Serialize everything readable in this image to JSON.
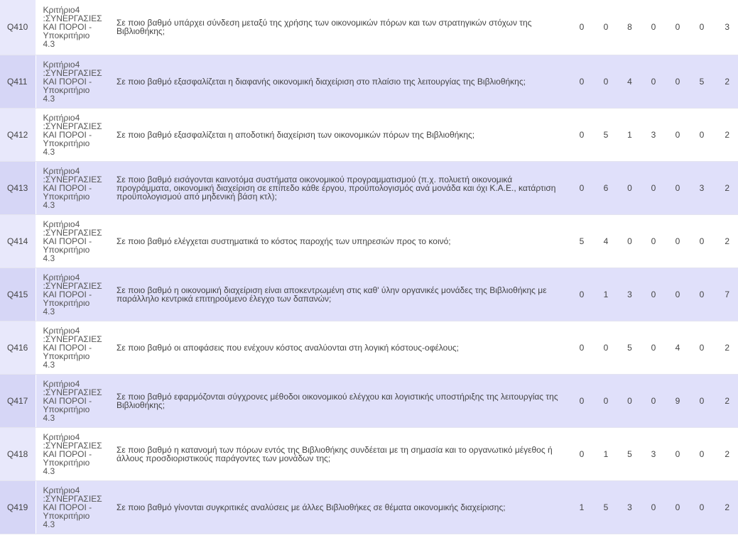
{
  "rows": [
    {
      "id": "Q410",
      "criterion": [
        "Κριτήριο4",
        ":ΣΥΝΕΡΓΑΣΙΕΣ",
        "ΚΑΙ ΠΟΡΟΙ -",
        "Υποκριτήριο",
        "4.3"
      ],
      "question": "Σε ποιο βαθμό υπάρχει σύνδεση μεταξύ της χρήσης των οικονομικών πόρων και των στρατηγικών στόχων της Βιβλιοθήκης;",
      "values": [
        "0",
        "0",
        "8",
        "0",
        "0",
        "0",
        "3"
      ]
    },
    {
      "id": "Q411",
      "criterion": [
        "Κριτήριο4",
        ":ΣΥΝΕΡΓΑΣΙΕΣ",
        "ΚΑΙ ΠΟΡΟΙ -",
        "Υποκριτήριο",
        "4.3"
      ],
      "question": "Σε ποιο βαθμό εξασφαλίζεται η διαφανής οικονομική διαχείριση στο πλαίσιο της λειτουργίας της Βιβλιοθήκης;",
      "values": [
        "0",
        "0",
        "4",
        "0",
        "0",
        "5",
        "2"
      ]
    },
    {
      "id": "Q412",
      "criterion": [
        "Κριτήριο4",
        ":ΣΥΝΕΡΓΑΣΙΕΣ",
        "ΚΑΙ ΠΟΡΟΙ -",
        "Υποκριτήριο",
        "4.3"
      ],
      "question": "Σε ποιο βαθμό εξασφαλίζεται η αποδοτική διαχείριση των οικονομικών πόρων της Βιβλιοθήκης;",
      "values": [
        "0",
        "5",
        "1",
        "3",
        "0",
        "0",
        "2"
      ]
    },
    {
      "id": "Q413",
      "criterion": [
        "Κριτήριο4",
        ":ΣΥΝΕΡΓΑΣΙΕΣ",
        "ΚΑΙ ΠΟΡΟΙ -",
        "Υποκριτήριο",
        "4.3"
      ],
      "question": "Σε ποιο βαθμό εισάγονται καινοτόμα συστήματα οικονομικού προγραμματισμού (π.χ. πολυετή οικονομικά προγράμματα, οικονομική διαχείριση σε επίπεδο κάθε έργου, προϋπολογισμός ανά μονάδα και όχι Κ.Α.Ε., κατάρτιση προϋπολογισμού από μηδενική βάση κτλ);",
      "values": [
        "0",
        "6",
        "0",
        "0",
        "0",
        "3",
        "2"
      ]
    },
    {
      "id": "Q414",
      "criterion": [
        "Κριτήριο4",
        ":ΣΥΝΕΡΓΑΣΙΕΣ",
        "ΚΑΙ ΠΟΡΟΙ -",
        "Υποκριτήριο",
        "4.3"
      ],
      "question": "Σε ποιο βαθμό ελέγχεται συστηματικά το κόστος παροχής των υπηρεσιών προς το κοινό;",
      "values": [
        "5",
        "4",
        "0",
        "0",
        "0",
        "0",
        "2"
      ]
    },
    {
      "id": "Q415",
      "criterion": [
        "Κριτήριο4",
        ":ΣΥΝΕΡΓΑΣΙΕΣ",
        "ΚΑΙ ΠΟΡΟΙ -",
        "Υποκριτήριο",
        "4.3"
      ],
      "question": "Σε ποιο βαθμό η οικονομική διαχείριση είναι αποκεντρωμένη στις καθ' ύλην οργανικές μονάδες της Βιβλιοθήκης με παράλληλο κεντρικά επιτηρούμενο έλεγχο των δαπανών;",
      "values": [
        "0",
        "1",
        "3",
        "0",
        "0",
        "0",
        "7"
      ]
    },
    {
      "id": "Q416",
      "criterion": [
        "Κριτήριο4",
        ":ΣΥΝΕΡΓΑΣΙΕΣ",
        "ΚΑΙ ΠΟΡΟΙ -",
        "Υποκριτήριο",
        "4.3"
      ],
      "question": "Σε ποιο βαθμό οι αποφάσεις που ενέχουν κόστος αναλύονται στη λογική κόστους-οφέλους;",
      "values": [
        "0",
        "0",
        "5",
        "0",
        "4",
        "0",
        "2"
      ]
    },
    {
      "id": "Q417",
      "criterion": [
        "Κριτήριο4",
        ":ΣΥΝΕΡΓΑΣΙΕΣ",
        "ΚΑΙ ΠΟΡΟΙ -",
        "Υποκριτήριο",
        "4.3"
      ],
      "question": "Σε ποιο βαθμό εφαρμόζονται σύγχρονες μέθοδοι οικονομικού ελέγχου και λογιστικής υποστήριξης της λειτουργίας της Βιβλιοθήκης;",
      "values": [
        "0",
        "0",
        "0",
        "0",
        "9",
        "0",
        "2"
      ]
    },
    {
      "id": "Q418",
      "criterion": [
        "Κριτήριο4",
        ":ΣΥΝΕΡΓΑΣΙΕΣ",
        "ΚΑΙ ΠΟΡΟΙ -",
        "Υποκριτήριο",
        "4.3"
      ],
      "question": "Σε ποιο βαθμό η κατανομή των πόρων εντός της Βιβλιοθήκης συνδέεται με τη σημασία και το οργανωτικό μέγεθος ή άλλους προσδιοριστικούς παράγοντες των μονάδων της;",
      "values": [
        "0",
        "1",
        "5",
        "3",
        "0",
        "0",
        "2"
      ]
    },
    {
      "id": "Q419",
      "criterion": [
        "Κριτήριο4",
        ":ΣΥΝΕΡΓΑΣΙΕΣ",
        "ΚΑΙ ΠΟΡΟΙ -",
        "Υποκριτήριο",
        "4.3"
      ],
      "question": "Σε ποιο βαθμό γίνονται συγκριτικές αναλύσεις με άλλες Βιβλιοθήκες σε θέματα οικονομικής διαχείρισης;",
      "values": [
        "1",
        "5",
        "3",
        "0",
        "0",
        "0",
        "2"
      ]
    }
  ]
}
